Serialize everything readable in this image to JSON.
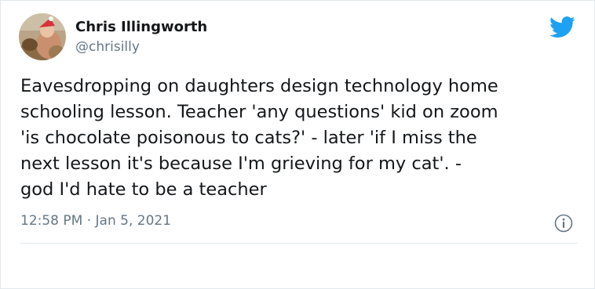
{
  "author": {
    "name": "Chris Illingworth",
    "handle": "@chrisilly",
    "avatar_icon": "profile-photo-avatar"
  },
  "tweet": {
    "text": "Eavesdropping on daughters design technology home\nschooling lesson. Teacher 'any questions' kid on zoom\n'is chocolate poisonous to cats?'  - later 'if I miss the\nnext lesson it's because I'm grieving for my cat'. -\ngod I'd hate to be a teacher",
    "time": "12:58 PM",
    "separator": "·",
    "date": "Jan 5, 2021"
  },
  "icons": {
    "brand": "twitter-bird-icon",
    "info": "info-icon"
  },
  "colors": {
    "brand_blue": "#1da1f2",
    "text_primary": "#14171a",
    "text_secondary": "#657786",
    "divider": "#e1e8ed"
  }
}
